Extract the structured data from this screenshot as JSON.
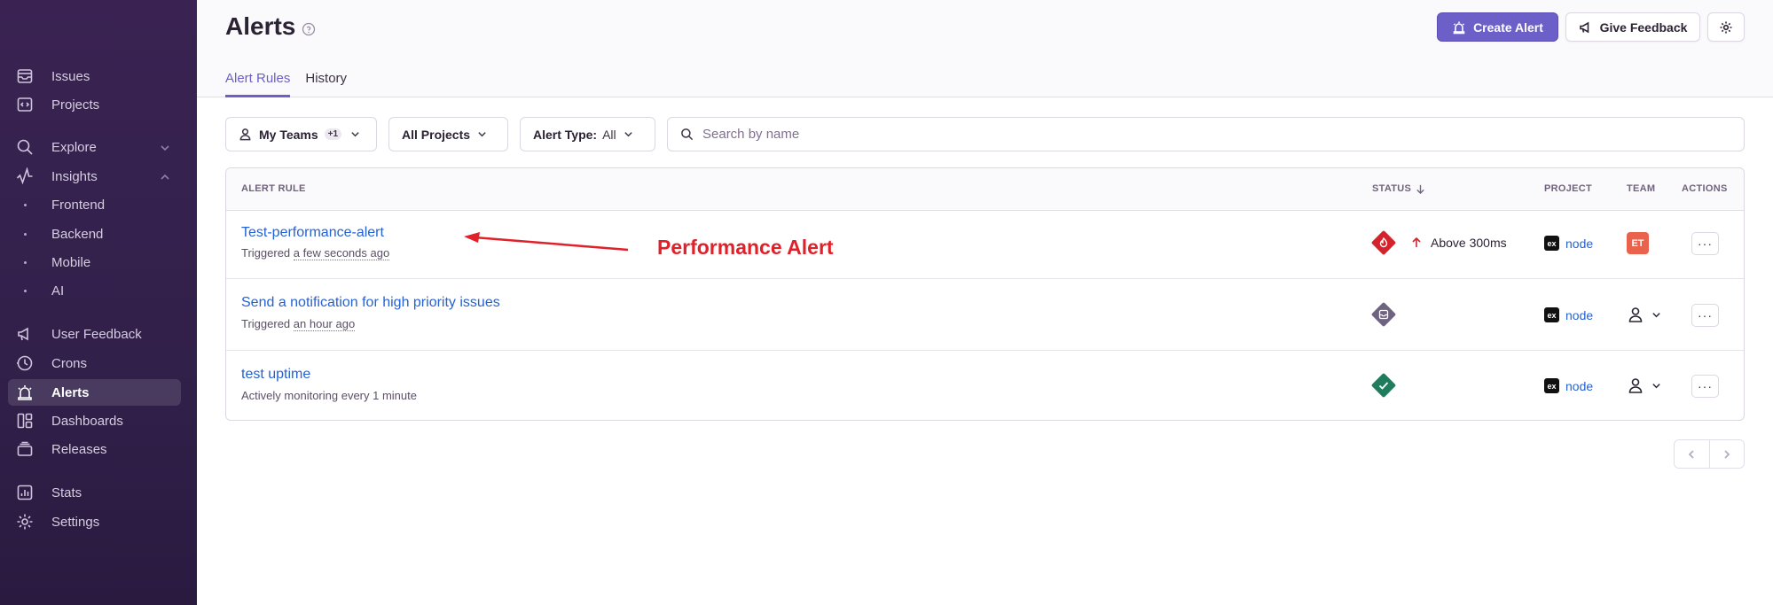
{
  "sidebar": {
    "items": [
      {
        "label": "Issues",
        "icon": "inbox-icon"
      },
      {
        "label": "Projects",
        "icon": "code-icon"
      },
      {
        "label": "Explore",
        "icon": "search-icon"
      },
      {
        "label": "Insights",
        "icon": "graph-icon"
      },
      {
        "label": "Frontend"
      },
      {
        "label": "Backend"
      },
      {
        "label": "Mobile"
      },
      {
        "label": "AI"
      },
      {
        "label": "User Feedback",
        "icon": "megaphone-icon"
      },
      {
        "label": "Crons",
        "icon": "timer-icon"
      },
      {
        "label": "Alerts",
        "icon": "siren-icon"
      },
      {
        "label": "Dashboards",
        "icon": "dashboard-icon"
      },
      {
        "label": "Releases",
        "icon": "releases-icon"
      },
      {
        "label": "Stats",
        "icon": "stats-icon"
      },
      {
        "label": "Settings",
        "icon": "gear-icon"
      }
    ],
    "active": "Alerts"
  },
  "header": {
    "title": "Alerts",
    "create_alert": "Create Alert",
    "give_feedback": "Give Feedback",
    "tabs": [
      {
        "label": "Alert Rules"
      },
      {
        "label": "History"
      }
    ],
    "active_tab": "Alert Rules"
  },
  "filters": {
    "teams": {
      "label": "My Teams",
      "count": "+1"
    },
    "projects": {
      "label": "All Projects"
    },
    "alert_type": {
      "label": "Alert Type:",
      "value": "All"
    },
    "search": {
      "placeholder": "Search by name",
      "value": ""
    }
  },
  "table": {
    "headers": {
      "rule": "ALERT RULE",
      "status": "STATUS",
      "project": "PROJECT",
      "team": "TEAM",
      "actions": "ACTIONS"
    },
    "rows": [
      {
        "name": "Test-performance-alert",
        "sub_prefix": "Triggered ",
        "sub_time": "a few seconds ago",
        "status": "critical",
        "status_text": "Above 300ms",
        "project": "node",
        "team": "ET"
      },
      {
        "name": "Send a notification for high priority issues",
        "sub_prefix": "Triggered ",
        "sub_time": "an hour ago",
        "status": "issue-alert",
        "status_text": "",
        "project": "node",
        "team": ""
      },
      {
        "name": "test uptime",
        "sub_prefix": "Actively monitoring every 1 minute",
        "sub_time": "",
        "status": "resolved",
        "status_text": "",
        "project": "node",
        "team": ""
      }
    ]
  },
  "annotation": {
    "label": "Performance Alert",
    "color": "#e0212a"
  },
  "colors": {
    "accent": "#6c5fc7",
    "link": "#2562d4",
    "critical": "#d4232a",
    "resolved": "#1f7d5e",
    "neutral": "#6e6380"
  }
}
